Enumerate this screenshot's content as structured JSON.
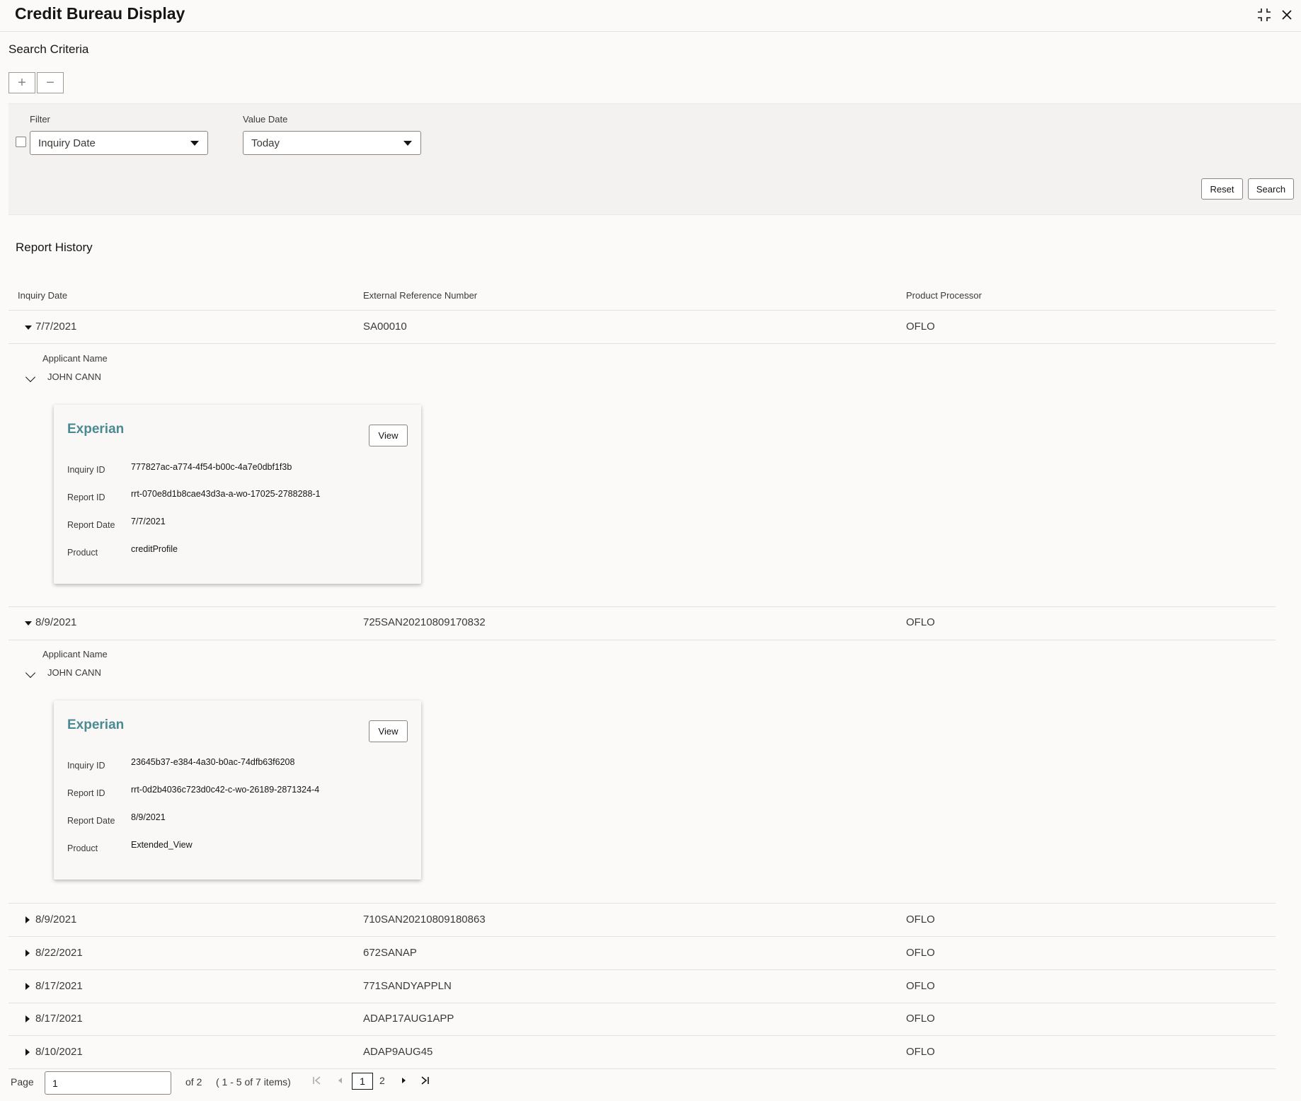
{
  "app": {
    "title": "Credit Bureau Display",
    "icons": [
      "collapse-icon",
      "close-icon"
    ]
  },
  "search": {
    "title": "Search Criteria",
    "add_glyph": "+",
    "remove_glyph": "−",
    "filter_label": "Filter",
    "filter_value": "Inquiry Date",
    "value_date_label": "Value Date",
    "value_date_value": "Today",
    "reset_label": "Reset",
    "search_label": "Search"
  },
  "history": {
    "title": "Report History",
    "columns": [
      "Inquiry Date",
      "External Reference Number",
      "Product Processor"
    ],
    "applicant_label": "Applicant Name",
    "rows": [
      {
        "date": "7/7/2021",
        "ref": "SA00010",
        "processor": "OFLO",
        "expanded": true,
        "applicant": "JOHN CANN",
        "card": {
          "bureau": "Experian",
          "view_label": "View",
          "fields": [
            {
              "k": "Inquiry ID",
              "v": "777827ac-a774-4f54-b00c-4a7e0dbf1f3b"
            },
            {
              "k": "Report ID",
              "v": "rrt-070e8d1b8cae43d3a-a-wo-17025-2788288-1"
            },
            {
              "k": "Report Date",
              "v": "7/7/2021"
            },
            {
              "k": "Product",
              "v": "creditProfile"
            }
          ]
        }
      },
      {
        "date": "8/9/2021",
        "ref": "725SAN20210809170832",
        "processor": "OFLO",
        "expanded": true,
        "applicant": "JOHN CANN",
        "card": {
          "bureau": "Experian",
          "view_label": "View",
          "fields": [
            {
              "k": "Inquiry ID",
              "v": "23645b37-e384-4a30-b0ac-74dfb63f6208"
            },
            {
              "k": "Report ID",
              "v": "rrt-0d2b4036c723d0c42-c-wo-26189-2871324-4"
            },
            {
              "k": "Report Date",
              "v": "8/9/2021"
            },
            {
              "k": "Product",
              "v": "Extended_View"
            }
          ]
        }
      },
      {
        "date": "8/9/2021",
        "ref": "710SAN20210809180863",
        "processor": "OFLO",
        "expanded": false
      },
      {
        "date": "8/22/2021",
        "ref": "672SANAP",
        "processor": "OFLO",
        "expanded": false
      },
      {
        "date": "8/17/2021",
        "ref": "771SANDYAPPLN",
        "processor": "OFLO",
        "expanded": false
      },
      {
        "date": "8/17/2021",
        "ref": "ADAP17AUG1APP",
        "processor": "OFLO",
        "expanded": false
      },
      {
        "date": "8/10/2021",
        "ref": "ADAP9AUG45",
        "processor": "OFLO",
        "expanded": false
      }
    ]
  },
  "pager": {
    "page_label": "Page",
    "page_value": "1",
    "of_text": "of 2",
    "range_text": "( 1 - 5 of 7 items)",
    "pages": [
      "1",
      "2"
    ],
    "current_page": "1"
  }
}
